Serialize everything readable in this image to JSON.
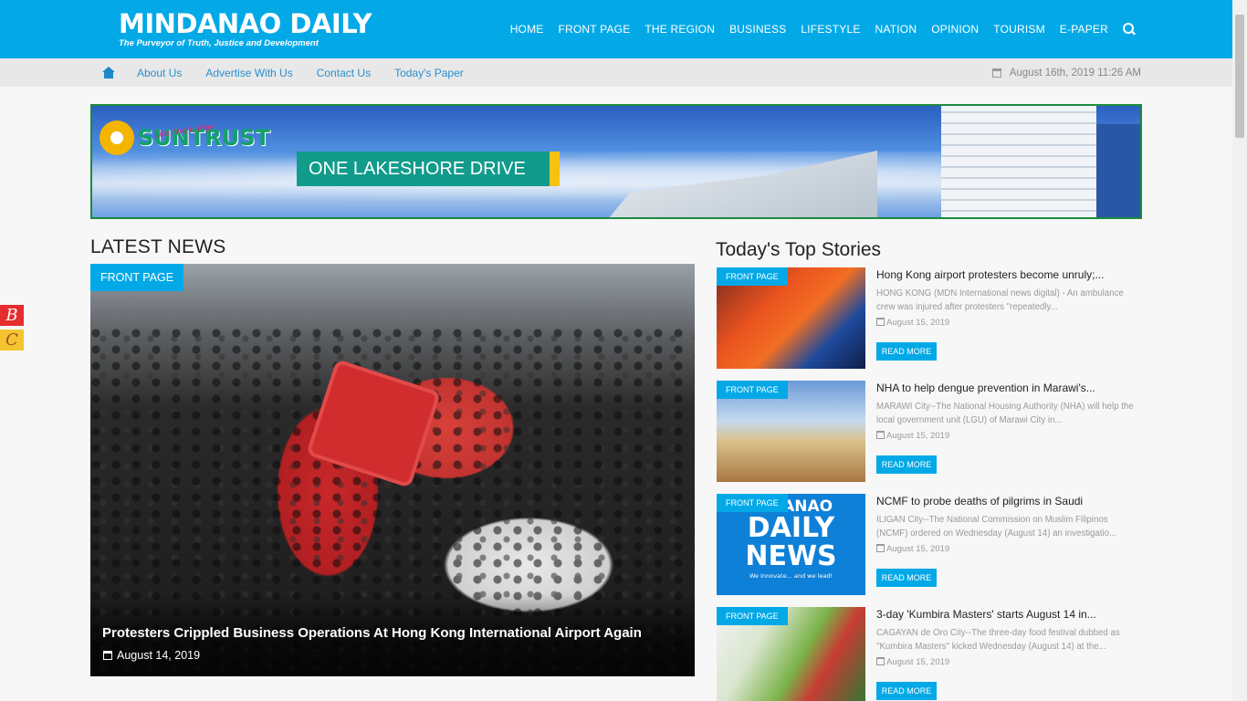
{
  "header": {
    "logo_title": "MINDANAO DAILY",
    "logo_tagline": "The Purveyor of Truth, Justice and Development",
    "nav": [
      "HOME",
      "FRONT PAGE",
      "THE REGION",
      "BUSINESS",
      "LIFESTYLE",
      "NATION",
      "OPINION",
      "TOURISM",
      "E-PAPER"
    ],
    "search_icon": "search-icon"
  },
  "subbar": {
    "links": [
      "About Us",
      "Advertise With Us",
      "Contact Us",
      "Today's Paper"
    ],
    "datetime": "August 16th, 2019  11:26 AM"
  },
  "banner": {
    "brand": "SUNTRUST",
    "tagline": "Live, Work, Play",
    "headline": "ONE LAKESHORE DRIVE"
  },
  "latest": {
    "title": "LATEST NEWS",
    "tag": "FRONT PAGE",
    "headline": "Protesters Crippled Business Operations At Hong Kong International Airport Again",
    "date": "August 14, 2019"
  },
  "top_stories": {
    "title": "Today's Top Stories",
    "read_more": "READ MORE",
    "items": [
      {
        "tag": "FRONT PAGE",
        "title": "Hong Kong airport protesters become unruly;...",
        "excerpt": "HONG KONG (MDN International news digital) - An ambulance crew was injured after protesters \"repeatedly...",
        "date": "August 15, 2019"
      },
      {
        "tag": "FRONT PAGE",
        "title": "NHA to help dengue prevention in Marawi's...",
        "excerpt": "MARAWI City--The National Housing Authority (NHA) will help the local government unit (LGU) of Marawi City in...",
        "date": "August 15, 2019"
      },
      {
        "tag": "FRONT PAGE",
        "title": "NCMF to probe deaths of pilgrims in Saudi",
        "excerpt": "ILIGAN City--The National Commission on Muslim Filipinos (NCMF) ordered on Wednesday (August 14) an investigatio...",
        "date": "August 15, 2019",
        "thumb_text": [
          "DANAO",
          "DAILY",
          "NEWS",
          "We Innovate... and we lead!"
        ]
      },
      {
        "tag": "FRONT PAGE",
        "title": "3-day 'Kumbira Masters' starts August 14 in...",
        "excerpt": "CAGAYAN de Oro City--The three-day food festival dubbed as \"Kumbira Masters\" kicked Wednesday (August 14) at the...",
        "date": "August 15, 2019"
      }
    ]
  },
  "side_badges": [
    "B",
    "C"
  ],
  "colors": {
    "brand_blue": "#03a9e7",
    "link_blue": "#2a8fd0",
    "ad_border": "#1b8a3e"
  }
}
